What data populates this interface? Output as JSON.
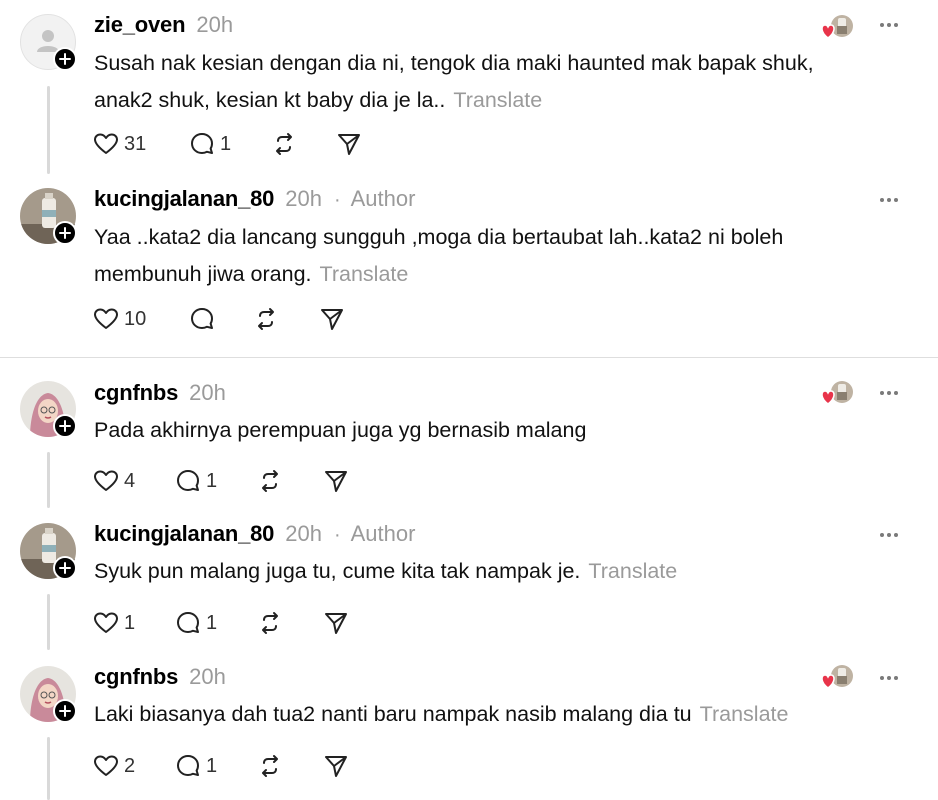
{
  "posts": [
    {
      "username": "zie_oven",
      "time": "20h",
      "author_tag": "",
      "lines": [
        "Susah nak kesian dengan dia ni, tengok dia maki haunted mak bapak shuk,",
        "anak2 shuk, kesian kt baby dia je la.."
      ],
      "translate": "Translate",
      "likes": "31",
      "replies": "1",
      "avatar": "default-user-icon",
      "reacted": true
    },
    {
      "username": "kucingjalanan_80",
      "time": "20h",
      "author_tag": "Author",
      "lines": [
        "Yaa ..kata2 dia lancang sungguh ,moga dia bertaubat lah..kata2 ni boleh",
        "membunuh jiwa orang."
      ],
      "translate": "Translate",
      "likes": "10",
      "replies": "",
      "avatar": "photo-bottle",
      "reacted": false
    },
    {
      "username": "cgnfnbs",
      "time": "20h",
      "author_tag": "",
      "lines": [
        "Pada akhirnya perempuan juga yg bernasib malang"
      ],
      "translate": "",
      "likes": "4",
      "replies": "1",
      "avatar": "illustration-hijab",
      "reacted": true
    },
    {
      "username": "kucingjalanan_80",
      "time": "20h",
      "author_tag": "Author",
      "lines": [
        "Syuk pun malang juga tu, cume kita tak nampak je."
      ],
      "translate": "Translate",
      "likes": "1",
      "replies": "1",
      "avatar": "photo-bottle",
      "reacted": false
    },
    {
      "username": "cgnfnbs",
      "time": "20h",
      "author_tag": "",
      "lines": [
        "Laki biasanya dah tua2 nanti baru nampak nasib malang dia tu"
      ],
      "translate": "Translate",
      "likes": "2",
      "replies": "1",
      "avatar": "illustration-hijab",
      "reacted": true
    }
  ],
  "icons": {
    "like": "heart-icon",
    "reply": "comment-icon",
    "repost": "repost-icon",
    "share": "send-icon",
    "more": "more-options-icon",
    "follow": "plus-icon"
  },
  "colors": {
    "text": "#000000",
    "muted": "#9a9a9a",
    "reaction_heart": "#e8344a",
    "thread_line": "#d9d9d9"
  }
}
